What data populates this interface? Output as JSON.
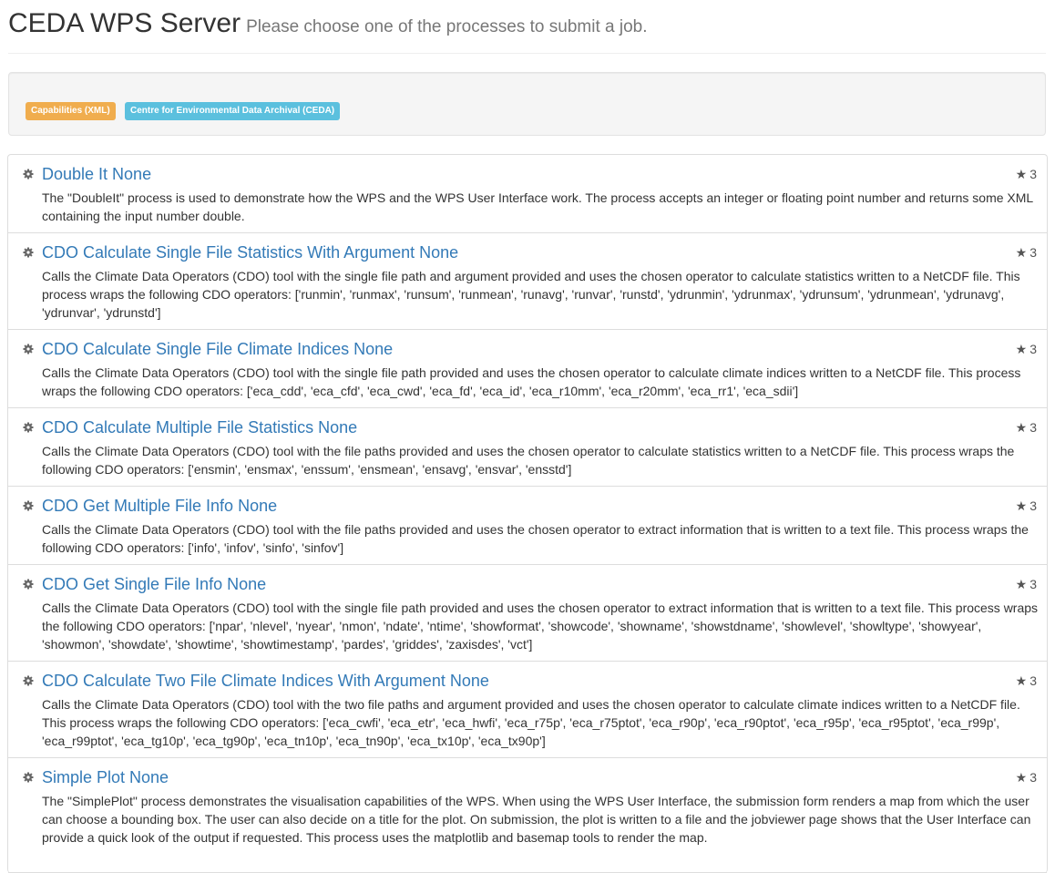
{
  "header": {
    "title": "CEDA WPS Server",
    "subtitle": "Please choose one of the processes to submit a job."
  },
  "labels": {
    "capabilities": "Capabilities (XML)",
    "ceda": "Centre for Environmental Data Archival (CEDA)"
  },
  "colors": {
    "link": "#337ab7",
    "label_warning": "#f0ad4e",
    "label_info": "#5bc0de"
  },
  "processes": [
    {
      "title": "Double It None",
      "rating": "3",
      "description": "The \"DoubleIt\" process is used to demonstrate how the WPS and the WPS User Interface work. The process accepts an integer or floating point number and returns some XML containing the input number double."
    },
    {
      "title": "CDO Calculate Single File Statistics With Argument None",
      "rating": "3",
      "description": "Calls the Climate Data Operators (CDO) tool with the single file path and argument provided and uses the chosen operator to calculate statistics written to a NetCDF file. This process wraps the following CDO operators: ['runmin', 'runmax', 'runsum', 'runmean', 'runavg', 'runvar', 'runstd', 'ydrunmin', 'ydrunmax', 'ydrunsum', 'ydrunmean', 'ydrunavg', 'ydrunvar', 'ydrunstd']"
    },
    {
      "title": "CDO Calculate Single File Climate Indices None",
      "rating": "3",
      "description": "Calls the Climate Data Operators (CDO) tool with the single file path provided and uses the chosen operator to calculate climate indices written to a NetCDF file. This process wraps the following CDO operators: ['eca_cdd', 'eca_cfd', 'eca_cwd', 'eca_fd', 'eca_id', 'eca_r10mm', 'eca_r20mm', 'eca_rr1', 'eca_sdii']"
    },
    {
      "title": "CDO Calculate Multiple File Statistics None",
      "rating": "3",
      "description": "Calls the Climate Data Operators (CDO) tool with the file paths provided and uses the chosen operator to calculate statistics written to a NetCDF file. This process wraps the following CDO operators: ['ensmin', 'ensmax', 'enssum', 'ensmean', 'ensavg', 'ensvar', 'ensstd']"
    },
    {
      "title": "CDO Get Multiple File Info None",
      "rating": "3",
      "description": "Calls the Climate Data Operators (CDO) tool with the file paths provided and uses the chosen operator to extract information that is written to a text file. This process wraps the following CDO operators: ['info', 'infov', 'sinfo', 'sinfov']"
    },
    {
      "title": "CDO Get Single File Info None",
      "rating": "3",
      "description": "Calls the Climate Data Operators (CDO) tool with the single file path provided and uses the chosen operator to extract information that is written to a text file. This process wraps the following CDO operators: ['npar', 'nlevel', 'nyear', 'nmon', 'ndate', 'ntime', 'showformat', 'showcode', 'showname', 'showstdname', 'showlevel', 'showltype', 'showyear', 'showmon', 'showdate', 'showtime', 'showtimestamp', 'pardes', 'griddes', 'zaxisdes', 'vct']"
    },
    {
      "title": "CDO Calculate Two File Climate Indices With Argument None",
      "rating": "3",
      "description": "Calls the Climate Data Operators (CDO) tool with the two file paths and argument provided and uses the chosen operator to calculate climate indices written to a NetCDF file. This process wraps the following CDO operators: ['eca_cwfi', 'eca_etr', 'eca_hwfi', 'eca_r75p', 'eca_r75ptot', 'eca_r90p', 'eca_r90ptot', 'eca_r95p', 'eca_r95ptot', 'eca_r99p', 'eca_r99ptot', 'eca_tg10p', 'eca_tg90p', 'eca_tn10p', 'eca_tn90p', 'eca_tx10p', 'eca_tx90p']"
    },
    {
      "title": "Simple Plot None",
      "rating": "3",
      "description": "The \"SimplePlot\" process demonstrates the visualisation capabilities of the WPS. When using the WPS User Interface, the submission form renders a map from which the user can choose a bounding box. The user can also decide on a title for the plot. On submission, the plot is written to a file and the jobviewer page shows that the User Interface can provide a quick look of the output if requested. This process uses the matplotlib and basemap tools to render the map."
    }
  ]
}
